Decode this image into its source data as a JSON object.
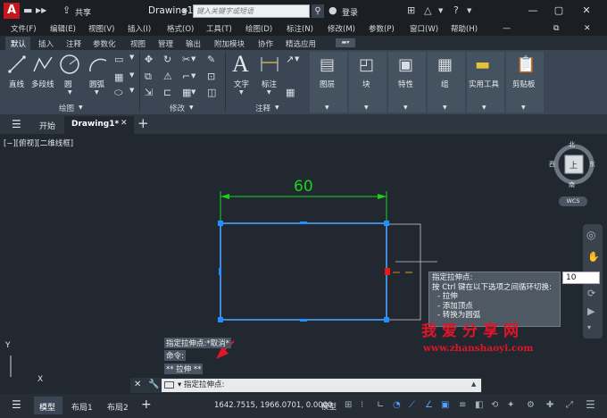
{
  "title_bar": {
    "app_logo": "A",
    "share_label": "共享",
    "doc_title": "Drawing1.dwg",
    "search_placeholder": "键入关键字或短语",
    "login_label": "登录"
  },
  "menu_bar": [
    "文件(F)",
    "编辑(E)",
    "视图(V)",
    "插入(I)",
    "格式(O)",
    "工具(T)",
    "绘图(D)",
    "标注(N)",
    "修改(M)",
    "参数(P)",
    "窗口(W)",
    "帮助(H)"
  ],
  "ribbon_tabs": [
    "默认",
    "插入",
    "注释",
    "参数化",
    "视图",
    "管理",
    "输出",
    "附加模块",
    "协作",
    "精选应用"
  ],
  "ribbon": {
    "draw_buttons": [
      "直线",
      "多段线",
      "圆",
      "圆弧"
    ],
    "draw_panel": "绘图",
    "modify_panel": "修改",
    "annot_buttons": [
      "文字",
      "标注"
    ],
    "annot_panel": "注释",
    "big_buttons": [
      "图层",
      "块",
      "特性",
      "组",
      "实用工具",
      "剪贴板"
    ],
    "dropdown_arrow": "▼"
  },
  "doc_tabs": {
    "start": "开始",
    "active": "Drawing1*"
  },
  "drawing": {
    "view_label": "[−][俯视][二维线框]",
    "dimension_value": "60",
    "viewcube": {
      "north": "北",
      "south": "南",
      "east": "东",
      "west": "西",
      "top": "上",
      "wcs": "WCS"
    }
  },
  "tooltip": {
    "lines": [
      "指定拉伸点:",
      "按 Ctrl 键在以下选项之间循环切换:",
      "- 拉伸",
      "- 添加顶点",
      "- 转换为圆弧"
    ],
    "dynamic_input": "10"
  },
  "command_line": {
    "history": [
      "指定拉伸点:*取消*",
      "命令:",
      "** 拉伸 **"
    ],
    "prompt": "▾ 指定拉伸点:"
  },
  "status_bar": {
    "tabs": [
      "模型",
      "布局1",
      "布局2"
    ],
    "coordinates": "1642.7515, 1966.0701, 0.0000",
    "model_label": "模型"
  },
  "watermark": {
    "cn": "我爱分享网",
    "url": "www.zhanshaoyi.com"
  },
  "colors": {
    "accent_red": "#e2142a",
    "grip_blue": "#1e90ff",
    "dim_green": "#1bd21b",
    "rectangle": "#4da3ff"
  }
}
